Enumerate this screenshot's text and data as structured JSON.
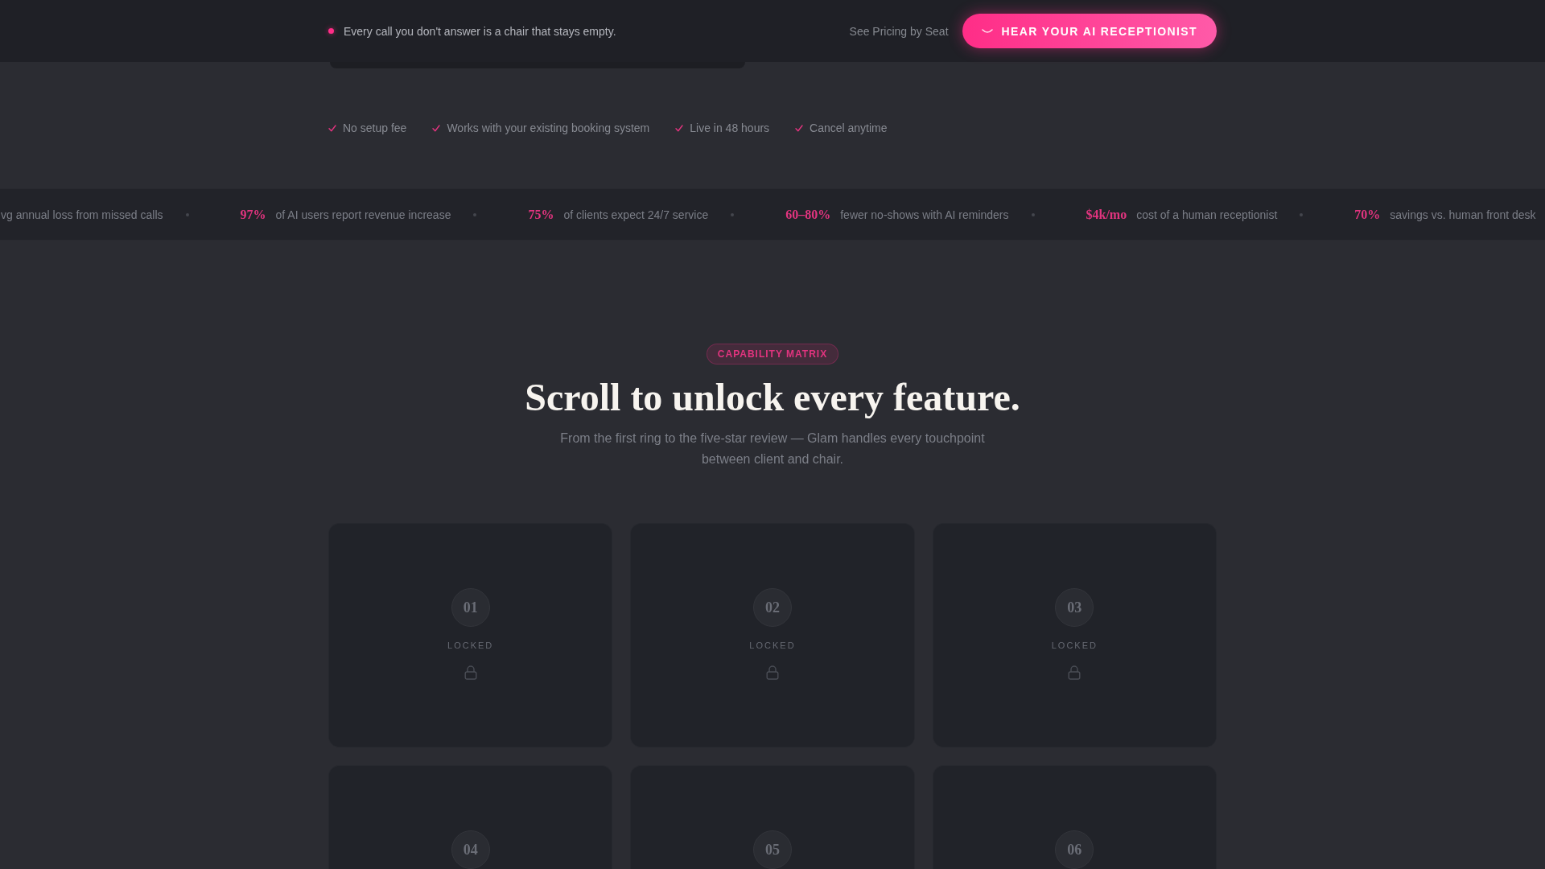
{
  "top_bar": {
    "announcement": "Every call you don't answer is a chair that stays empty.",
    "pricing_link": "See Pricing by Seat",
    "cta_button": "HEAR YOUR AI RECEPTIONIST"
  },
  "benefits": [
    "No setup fee",
    "Works with your existing booking system",
    "Live in 48 hours",
    "Cancel anytime"
  ],
  "ticker": [
    {
      "label": "vg annual loss from missed calls"
    },
    {
      "value": "97%",
      "label": "of AI users report revenue increase"
    },
    {
      "value": "75%",
      "label": "of clients expect 24/7 service"
    },
    {
      "value": "60–80%",
      "label": "fewer no-shows with AI reminders"
    },
    {
      "value": "$4k/mo",
      "label": "cost of a human receptionist"
    },
    {
      "value": "70%",
      "label": "savings vs. human front desk"
    }
  ],
  "capabilities": {
    "badge": "CAPABILITY MATRIX",
    "title": "Scroll to unlock every feature.",
    "subtitle": "From the first ring to the five-star review — Glam handles every touchpoint between client and chair.",
    "cards": [
      {
        "number": "01",
        "status": "LOCKED"
      },
      {
        "number": "02",
        "status": "LOCKED"
      },
      {
        "number": "03",
        "status": "LOCKED"
      },
      {
        "number": "04"
      },
      {
        "number": "05"
      },
      {
        "number": "06"
      }
    ]
  }
}
